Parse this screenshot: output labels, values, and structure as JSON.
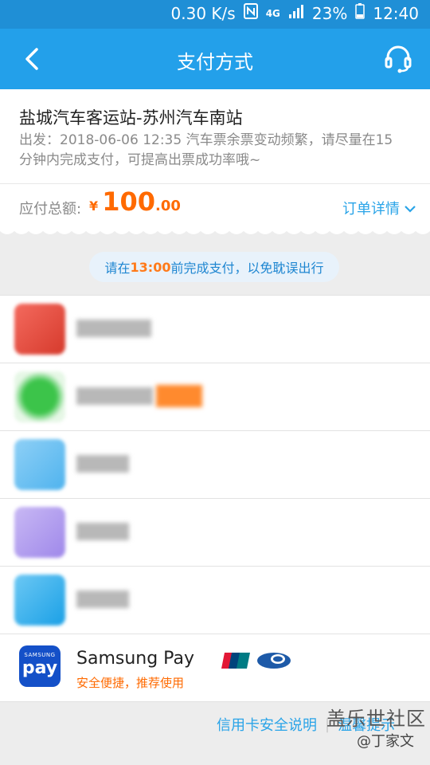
{
  "status_bar": {
    "net_speed": "0.30 K/s",
    "network_type": "4G",
    "battery": "23%",
    "time": "12:40",
    "icons": [
      "nfc-icon",
      "signal-icon",
      "battery-icon"
    ]
  },
  "header": {
    "title": "支付方式",
    "back_icon": "chevron-left-icon",
    "service_icon": "headset-icon"
  },
  "order": {
    "route": "盐城汽车客运站-苏州汽车南站",
    "notice": "出发：2018-06-06 12:35 汽车票余票变动频繁，请尽量在15分钟内完成支付，可提高出票成功率哦~",
    "amount_label": "应付总额:",
    "currency": "¥",
    "amount_int": "100",
    "amount_dec": ".00",
    "detail_label": "订单详情"
  },
  "deadline": {
    "prefix": "请在",
    "time": "13:00",
    "suffix": "前完成支付，以免耽误出行"
  },
  "samsung_pay": {
    "logo_brand": "SAMSUNG",
    "logo_word": "pay",
    "name": "Samsung Pay",
    "subtitle": "安全便捷，推荐使用"
  },
  "footer": {
    "link1": "信用卡安全说明",
    "link2": "温馨提示"
  },
  "watermark": {
    "main": "盖乐世社区",
    "sub": "@丁家文"
  },
  "colors": {
    "header_blue": "#23a0ea",
    "accent_orange": "#ff6a00",
    "link_blue": "#2aa4e8"
  }
}
